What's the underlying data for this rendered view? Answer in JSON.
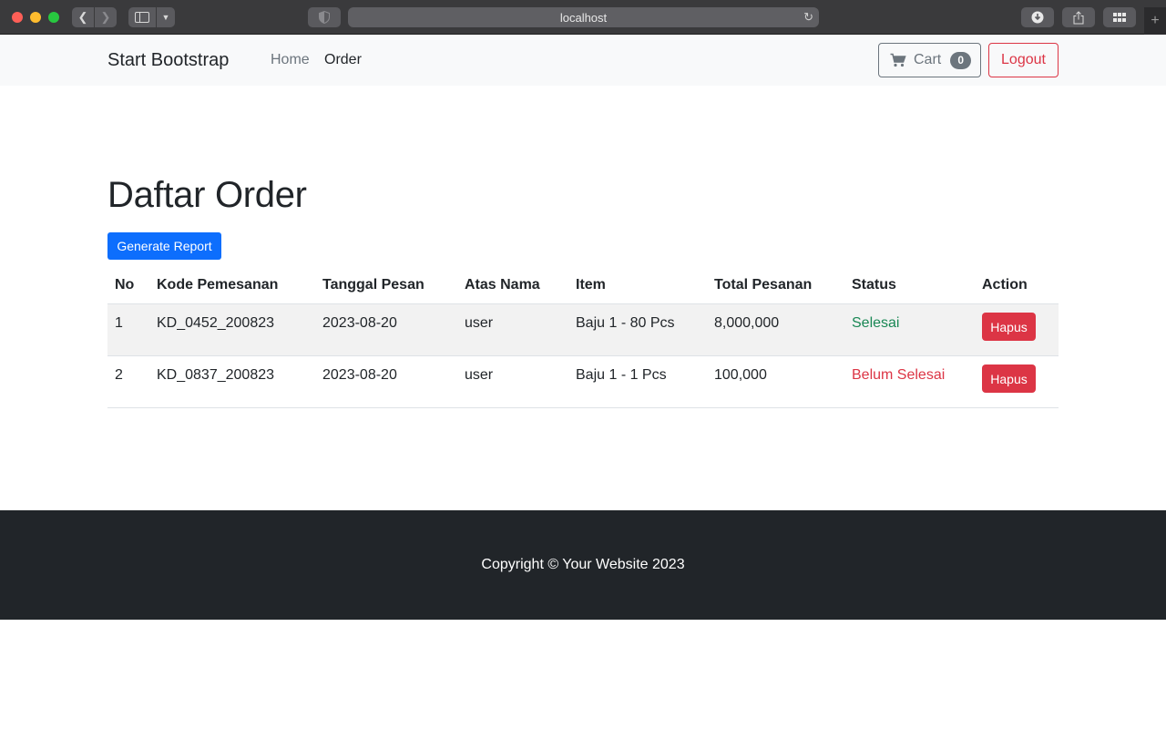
{
  "browser": {
    "url": "localhost"
  },
  "navbar": {
    "brand": "Start Bootstrap",
    "links": [
      "Home",
      "Order"
    ],
    "cart_label": "Cart",
    "cart_count": "0",
    "logout_label": "Logout"
  },
  "main": {
    "title": "Daftar Order",
    "report_button": "Generate Report",
    "table": {
      "headers": [
        "No",
        "Kode Pemesanan",
        "Tanggal Pesan",
        "Atas Nama",
        "Item",
        "Total Pesanan",
        "Status",
        "Action"
      ],
      "rows": [
        {
          "no": "1",
          "kode": "KD_0452_200823",
          "tanggal": "2023-08-20",
          "atas_nama": "user",
          "item": "Baju 1 - 80 Pcs",
          "total": "8,000,000",
          "status": "Selesai",
          "action": "Hapus"
        },
        {
          "no": "2",
          "kode": "KD_0837_200823",
          "tanggal": "2023-08-20",
          "atas_nama": "user",
          "item": "Baju 1 - 1 Pcs",
          "total": "100,000",
          "status": "Belum Selesai",
          "action": "Hapus"
        }
      ]
    }
  },
  "footer": {
    "copyright": "Copyright © Your Website 2023"
  },
  "colors": {
    "primary": "#0d6efd",
    "danger": "#dc3545",
    "success": "#198754",
    "secondary": "#6c757d",
    "footer_bg": "#212529"
  }
}
